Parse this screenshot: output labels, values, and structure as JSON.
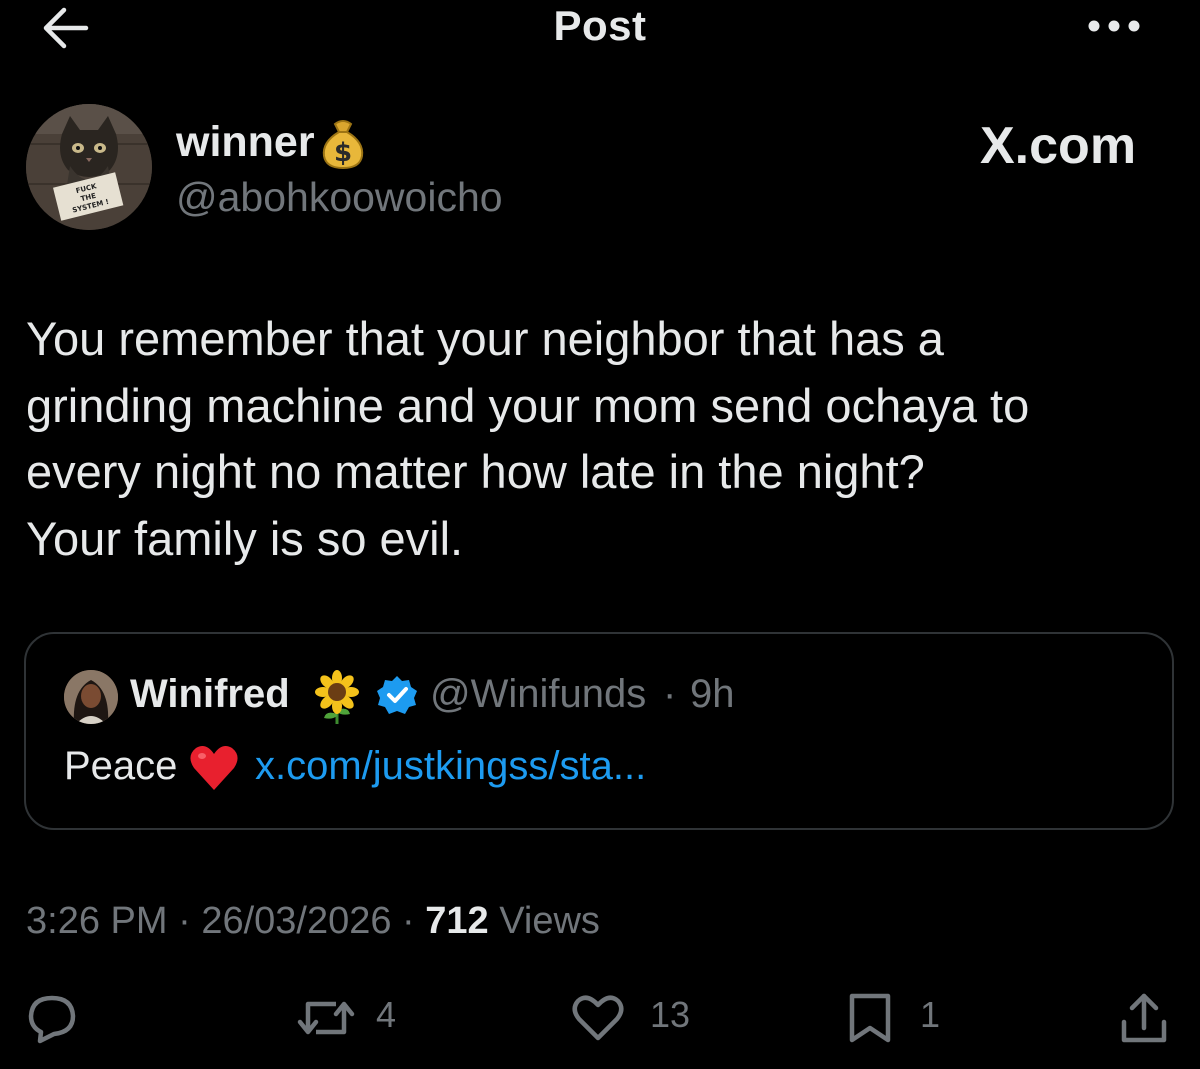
{
  "header": {
    "title": "Post"
  },
  "author": {
    "name": "winner",
    "handle": "@abohkoowoicho",
    "badge_icon": "money-bag-emoji",
    "avatar_sign_text": [
      "FUCK",
      "THE",
      "SYSTEM !"
    ]
  },
  "watermark": "X.com",
  "post": {
    "lines": [
      "You remember that your neighbor that has a",
      "grinding machine and your mom send ochaya to",
      "every night no matter how late in the night?",
      "Your family is so evil."
    ]
  },
  "quote": {
    "name": "Winifred",
    "name_emoji": "sunflower-emoji",
    "verified": true,
    "handle": "@Winifunds",
    "separator": "·",
    "time": "9h",
    "text": "Peace",
    "text_emoji": "red-heart-emoji",
    "link": "x.com/justkingss/sta..."
  },
  "meta": {
    "time": "3:26 PM",
    "sep1": " · ",
    "date": "26/03/2026",
    "sep2": " · ",
    "views_count": "712",
    "views_label": " Views"
  },
  "actions": {
    "reply_count": "",
    "repost_count": "4",
    "like_count": "13",
    "bookmark_count": "1"
  },
  "colors": {
    "background": "#000000",
    "text": "#e7e9ea",
    "muted": "#71767b",
    "link": "#1d9bf0",
    "border": "#2f3336"
  }
}
